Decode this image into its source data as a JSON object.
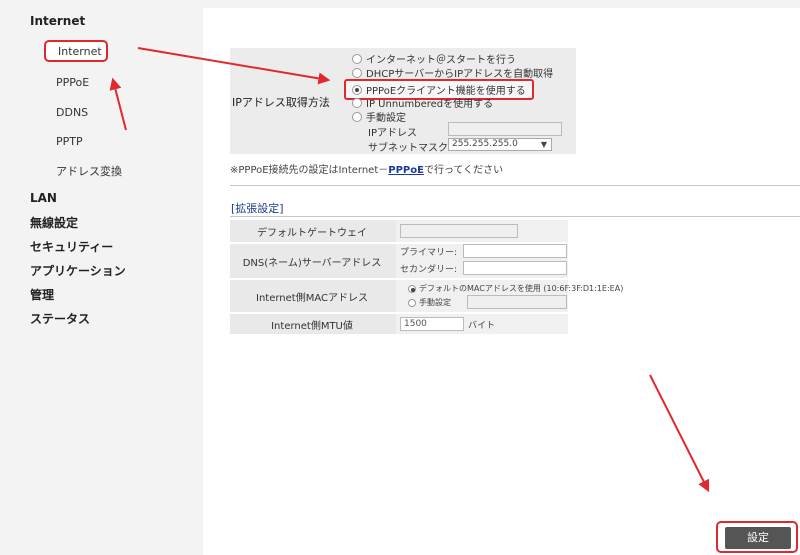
{
  "sidebar": {
    "title": "Internet",
    "sub_items": [
      {
        "label": "Internet",
        "active": true
      },
      {
        "label": "PPPoE"
      },
      {
        "label": "DDNS"
      },
      {
        "label": "PPTP"
      },
      {
        "label": "アドレス変換"
      }
    ],
    "main_items": [
      {
        "label": "LAN"
      },
      {
        "label": "無線設定"
      },
      {
        "label": "セキュリティー"
      },
      {
        "label": "アプリケーション"
      },
      {
        "label": "管理"
      },
      {
        "label": "ステータス"
      }
    ]
  },
  "ip_settings": {
    "label": "IPアドレス取得方法",
    "options": [
      {
        "label": "インターネット＠スタートを行う",
        "selected": false
      },
      {
        "label": "DHCPサーバーからIPアドレスを自動取得",
        "selected": false
      },
      {
        "label": "PPPoEクライアント機能を使用する",
        "selected": true
      },
      {
        "label": "IP Unnumberedを使用する",
        "selected": false
      },
      {
        "label": "手動設定",
        "selected": false
      }
    ],
    "ip_address_label": "IPアドレス",
    "ip_address_value": "",
    "subnet_label": "サブネットマスク",
    "subnet_value": "255.255.255.0",
    "select_arrow": "▼"
  },
  "note": {
    "prefix": "※PPPoE接続先の設定はInternet－",
    "link": "PPPoE",
    "suffix": "で行ってください"
  },
  "extended": {
    "title": "[拡張設定]",
    "gateway_label": "デフォルトゲートウェイ",
    "gateway_value": "",
    "dns_label": "DNS(ネーム)サーバーアドレス",
    "primary_label": "プライマリー:",
    "secondary_label": "セカンダリー:",
    "primary_value": "",
    "secondary_value": "",
    "mac_label": "Internet側MACアドレス",
    "mac_default_option": "デフォルトのMACアドレスを使用 (10:6F:3F:D1:1E:EA)",
    "mac_manual_option": "手動設定",
    "mac_manual_value": "",
    "mtu_label": "Internet側MTU値",
    "mtu_value": "1500",
    "mtu_unit": "バイト"
  },
  "submit_label": "設定",
  "colors": {
    "annotation": "#e0282e",
    "link": "#1a3aa0",
    "button": "#555555"
  }
}
